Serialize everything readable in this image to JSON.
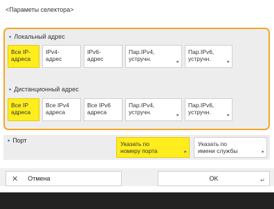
{
  "title": "<Параметы селектора>",
  "local": {
    "label": "Локальный адрес",
    "buttons": [
      {
        "line1": "Все IP-",
        "line2": "адреса",
        "selected": true
      },
      {
        "line1": "IPv4-",
        "line2": "адрес",
        "selected": false
      },
      {
        "line1": "IPv6-",
        "line2": "адрес",
        "selected": false
      },
      {
        "line1": "Пар.IPv4,",
        "line2": "устручн.",
        "selected": false
      },
      {
        "line1": "Пар.IPv6,",
        "line2": "устручн.",
        "selected": false
      }
    ]
  },
  "remote": {
    "label": "Дистанционный адрес",
    "buttons": [
      {
        "line1": "Все IP",
        "line2": "адреса",
        "selected": true
      },
      {
        "line1": "Все IPv4",
        "line2": "адреса",
        "selected": false
      },
      {
        "line1": "Все IPv6",
        "line2": "адреса",
        "selected": false
      },
      {
        "line1": "Пар.IPv4,",
        "line2": "устручн.",
        "selected": false
      },
      {
        "line1": "Пар.IPv6,",
        "line2": "устручн.",
        "selected": false
      }
    ]
  },
  "port": {
    "label": "Порт",
    "by_number": {
      "line1": "Указать по",
      "line2": "номеру порта"
    },
    "by_service": {
      "line1": "Указать по",
      "line2": "имени службы"
    }
  },
  "actions": {
    "cancel": "Отмена",
    "ok": "OK"
  },
  "colors": {
    "accent_border": "#f4a526",
    "selected": "#ffed1d",
    "bullet": "#1f66c7"
  }
}
